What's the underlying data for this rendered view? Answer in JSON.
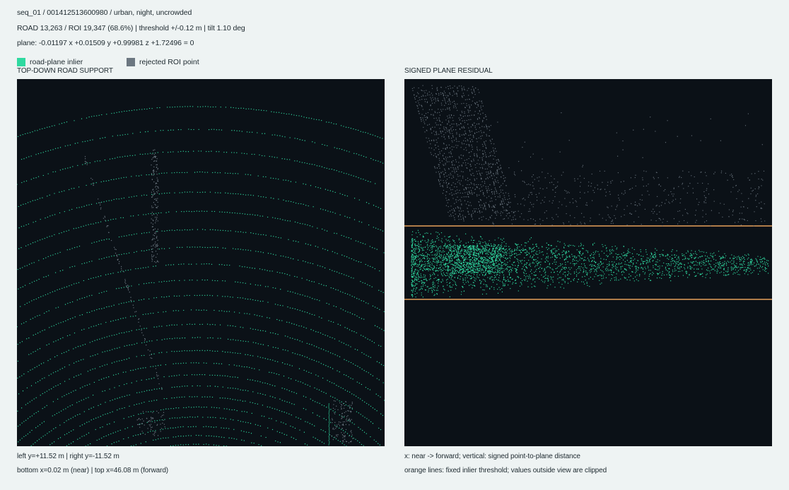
{
  "header": {
    "sequence_line": "seq_01 / 001412513600980 / urban, night, uncrowded",
    "stats_line": "ROAD 13,263 / ROI 19,347 (68.6%)  |  threshold +/-0.12 m  |  tilt 1.10 deg",
    "plane_line": "plane: -0.01197 x +0.01509 y +0.99981 z +1.72496 = 0"
  },
  "legend": {
    "inlier_label": "road-plane inlier",
    "rejected_label": "rejected ROI point",
    "inlier_color": "#2fd9a0",
    "rejected_color": "#6c7781"
  },
  "left_panel": {
    "title": "TOP-DOWN ROAD SUPPORT",
    "footer_line1": "left y=+11.52 m  |  right y=-11.52 m",
    "footer_line2": "bottom x=0.02 m (near)  |  top x=46.08 m (forward)"
  },
  "right_panel": {
    "title": "SIGNED PLANE RESIDUAL",
    "footer_line1": "x: near -> forward; vertical: signed point-to-plane distance",
    "footer_line2": "orange lines: fixed inlier threshold; values outside view are clipped",
    "threshold_color": "#e8a05a"
  },
  "colors": {
    "page_bg": "#eef3f3",
    "panel_bg": "#0b1117"
  }
}
